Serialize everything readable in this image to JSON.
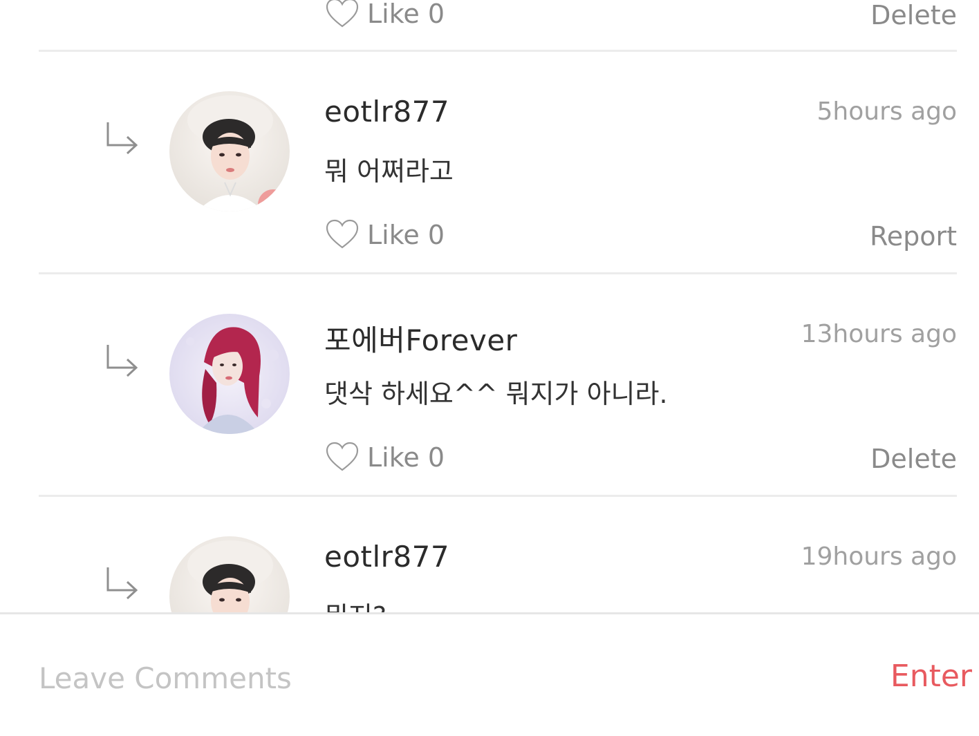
{
  "comments": [
    {
      "username": "",
      "time": "",
      "text": "",
      "like_label": "Like 0",
      "action_label": "Delete"
    },
    {
      "username": "eotlr877",
      "time": "5hours ago",
      "text": "뭐 어쩌라고",
      "like_label": "Like 0",
      "action_label": "Report"
    },
    {
      "username": "포에버Forever",
      "time": "13hours ago",
      "text": "댓삭 하세요^^ 뭐지가 아니라.",
      "like_label": "Like 0",
      "action_label": "Delete"
    },
    {
      "username": "eotlr877",
      "time": "19hours ago",
      "text": "뭐지?",
      "like_label": "",
      "action_label": ""
    }
  ],
  "composer": {
    "placeholder": "Leave Comments",
    "enter_label": "Enter"
  },
  "colors": {
    "accent": "#e85a5f",
    "muted_text": "#8a8a8a",
    "timestamp": "#a0a0a0",
    "divider": "#ececec"
  }
}
